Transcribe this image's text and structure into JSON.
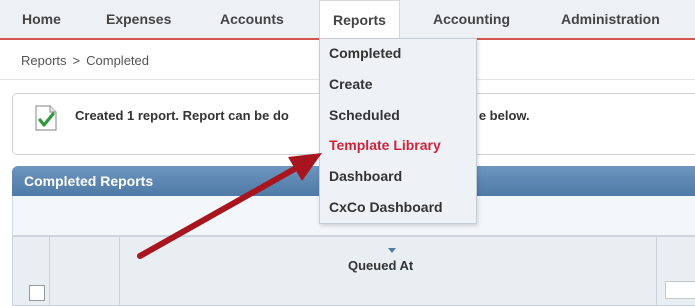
{
  "nav": {
    "items": [
      {
        "label": "Home"
      },
      {
        "label": "Expenses"
      },
      {
        "label": "Accounts"
      },
      {
        "label": "Reports"
      },
      {
        "label": "Accounting"
      },
      {
        "label": "Administration"
      }
    ],
    "active": "Reports"
  },
  "breadcrumb": {
    "parent": "Reports",
    "separator": ">",
    "current": "Completed"
  },
  "message": {
    "text_start": "Created 1 report. Report can be do",
    "text_end": "e below.",
    "icon": "document-check-icon"
  },
  "panel": {
    "title": "Completed Reports",
    "column_header": "Queued At"
  },
  "dropdown": {
    "items": [
      {
        "label": "Completed"
      },
      {
        "label": "Create"
      },
      {
        "label": "Scheduled"
      },
      {
        "label": "Template Library"
      },
      {
        "label": "Dashboard"
      },
      {
        "label": "CxCo Dashboard"
      }
    ],
    "highlighted": "Template Library",
    "highlight_color": "#d0243a"
  },
  "annotation": {
    "arrow_color": "#a8151f",
    "arrow_icon": "annotation-arrow-icon"
  }
}
